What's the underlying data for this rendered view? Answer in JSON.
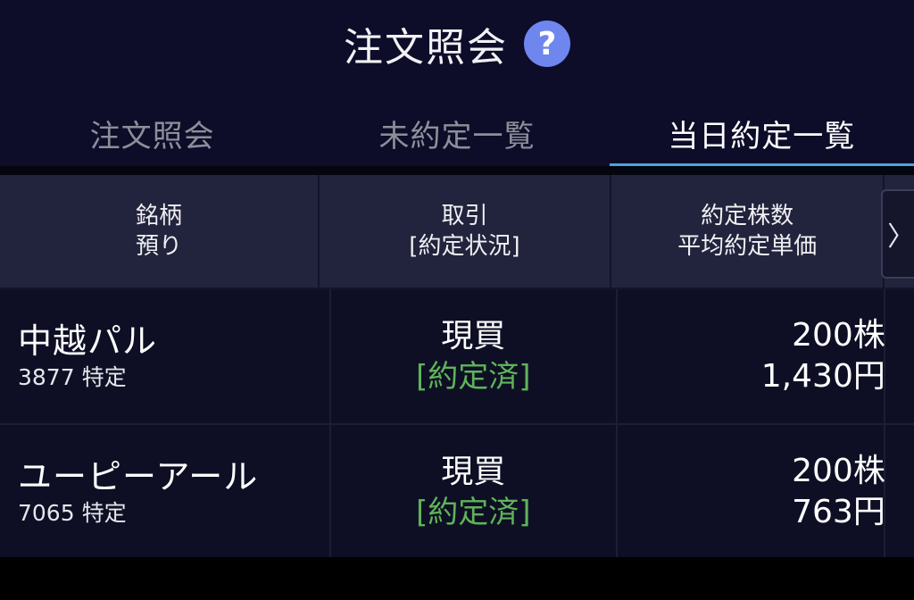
{
  "header": {
    "title": "注文照会",
    "help_icon": "?"
  },
  "tabs": [
    {
      "label": "注文照会",
      "active": false
    },
    {
      "label": "未約定一覧",
      "active": false
    },
    {
      "label": "当日約定一覧",
      "active": true
    }
  ],
  "table": {
    "columns": [
      {
        "line1": "銘柄",
        "line2": "預り"
      },
      {
        "line1": "取引",
        "line2": "[約定状況]"
      },
      {
        "line1": "約定株数",
        "line2": "平均約定単価"
      }
    ],
    "scroll_glyph": "〉",
    "rows": [
      {
        "name": "中越パル",
        "code_account": "3877 特定",
        "trade": "現買",
        "status": "[約定済]",
        "quantity": "200株",
        "avg_price": "1,430円"
      },
      {
        "name": "ユーピーアール",
        "code_account": "7065 特定",
        "trade": "現買",
        "status": "[約定済]",
        "quantity": "200株",
        "avg_price": "763円"
      }
    ]
  },
  "colors": {
    "header_bg": "#0d0d2a",
    "tab_underline": "#4aa3e6",
    "help_icon_bg": "#6f86ee",
    "table_header_bg": "#22233c",
    "row_bg": "#0e0f24",
    "status_green": "#5fb35a"
  }
}
